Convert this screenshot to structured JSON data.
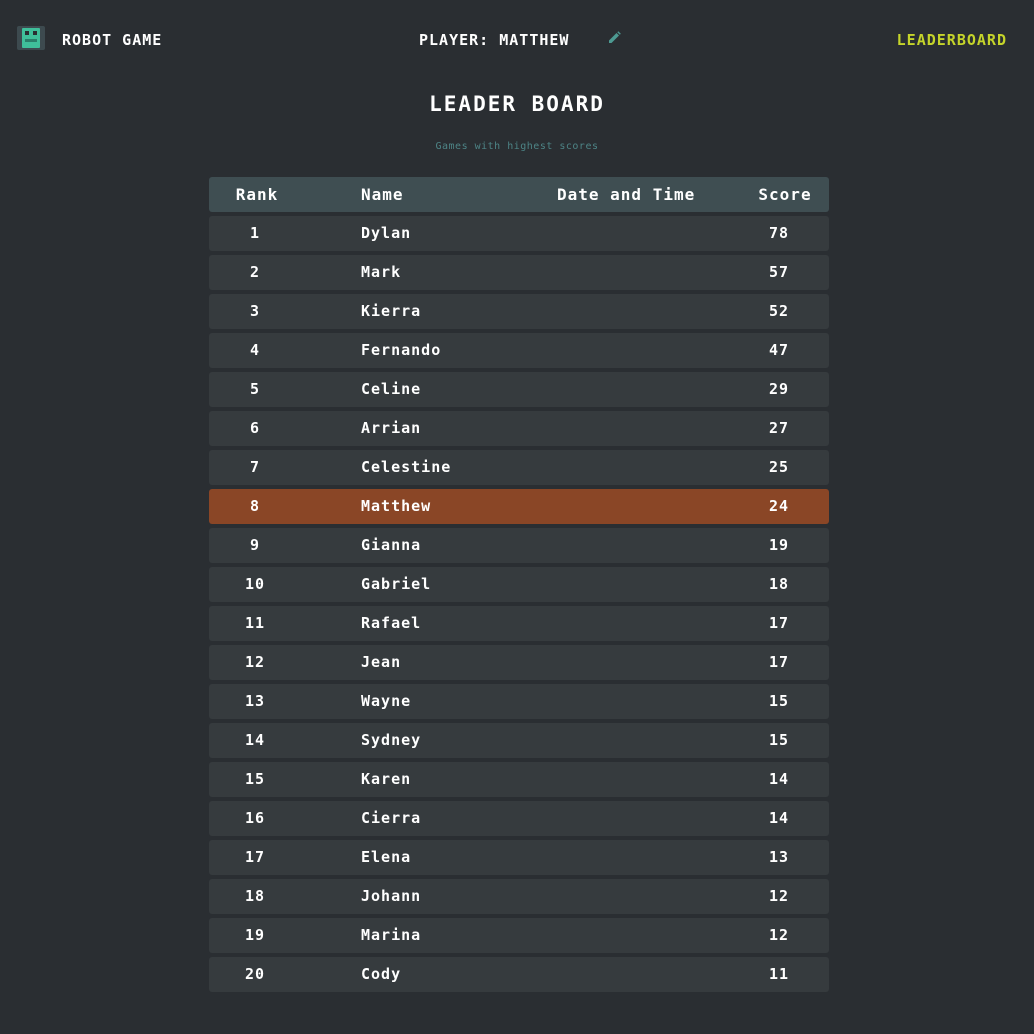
{
  "header": {
    "brand": "ROBOT GAME",
    "player": "PLAYER: MATTHEW",
    "nav_leaderboard": "LEADERBOARD"
  },
  "page": {
    "title": "LEADER BOARD",
    "subtitle": "Games with highest scores"
  },
  "table": {
    "columns": {
      "rank": "Rank",
      "name": "Name",
      "date": "Date and Time",
      "score": "Score"
    },
    "highlight_rank": "8",
    "rows": [
      {
        "rank": "1",
        "name": "Dylan",
        "score": "78"
      },
      {
        "rank": "2",
        "name": "Mark",
        "score": "57"
      },
      {
        "rank": "3",
        "name": "Kierra",
        "score": "52"
      },
      {
        "rank": "4",
        "name": "Fernando",
        "score": "47"
      },
      {
        "rank": "5",
        "name": "Celine",
        "score": "29"
      },
      {
        "rank": "6",
        "name": "Arrian",
        "score": "27"
      },
      {
        "rank": "7",
        "name": "Celestine",
        "score": "25"
      },
      {
        "rank": "8",
        "name": "Matthew",
        "score": "24"
      },
      {
        "rank": "9",
        "name": "Gianna",
        "score": "19"
      },
      {
        "rank": "10",
        "name": "Gabriel",
        "score": "18"
      },
      {
        "rank": "11",
        "name": "Rafael",
        "score": "17"
      },
      {
        "rank": "12",
        "name": "Jean",
        "score": "17"
      },
      {
        "rank": "13",
        "name": "Wayne",
        "score": "15"
      },
      {
        "rank": "14",
        "name": "Sydney",
        "score": "15"
      },
      {
        "rank": "15",
        "name": "Karen",
        "score": "14"
      },
      {
        "rank": "16",
        "name": "Cierra",
        "score": "14"
      },
      {
        "rank": "17",
        "name": "Elena",
        "score": "13"
      },
      {
        "rank": "18",
        "name": "Johann",
        "score": "12"
      },
      {
        "rank": "19",
        "name": "Marina",
        "score": "12"
      },
      {
        "rank": "20",
        "name": "Cody",
        "score": "11"
      }
    ]
  },
  "colors": {
    "background": "#2a2e32",
    "accent": "#c5d42a",
    "highlight_row": "#8a4626",
    "subtitle": "#4d8486"
  },
  "icons": {
    "logo": "robot-icon",
    "edit": "pencil-icon"
  }
}
